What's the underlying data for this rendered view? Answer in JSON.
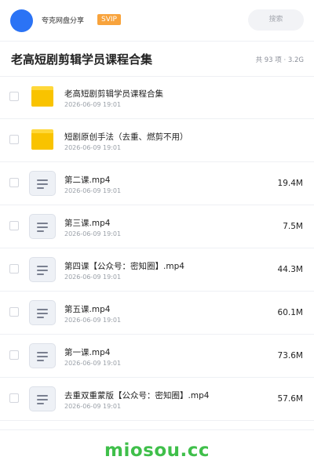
{
  "app": {
    "name": "夸克网盘分享",
    "badge": "SVIP",
    "search_label": "搜索"
  },
  "folder": {
    "title": "老高短剧剪辑学员课程合集",
    "summary": "共 93 项 · 3.2G"
  },
  "files": [
    {
      "icon": "folder-icon",
      "name": "老高短剧剪辑学员课程合集",
      "date": "2026-06-09 19:01",
      "size": ""
    },
    {
      "icon": "folder-icon",
      "name": "短剧原创手法（去重、燃剪不用）",
      "date": "2026-06-09 19:01",
      "size": ""
    },
    {
      "icon": "video-file-icon",
      "name": "第二课.mp4",
      "date": "2026-06-09 19:01",
      "size": "19.4M"
    },
    {
      "icon": "video-file-icon",
      "name": "第三课.mp4",
      "date": "2026-06-09 19:01",
      "size": "7.5M"
    },
    {
      "icon": "video-file-icon",
      "name": "第四课【公众号：密知圈】.mp4",
      "date": "2026-06-09 19:01",
      "size": "44.3M"
    },
    {
      "icon": "video-file-icon",
      "name": "第五课.mp4",
      "date": "2026-06-09 19:01",
      "size": "60.1M"
    },
    {
      "icon": "video-file-icon",
      "name": "第一课.mp4",
      "date": "2026-06-09 19:01",
      "size": "73.6M"
    },
    {
      "icon": "video-file-icon",
      "name": "去重双重蒙版【公众号：密知圈】.mp4",
      "date": "2026-06-09 19:01",
      "size": "57.6M"
    }
  ],
  "watermark": "miosou.cc",
  "colors": {
    "accent": "#2b73f5",
    "svip": "#f8a33c",
    "folder": "#f9c300",
    "watermark": "#3fbf4a"
  }
}
